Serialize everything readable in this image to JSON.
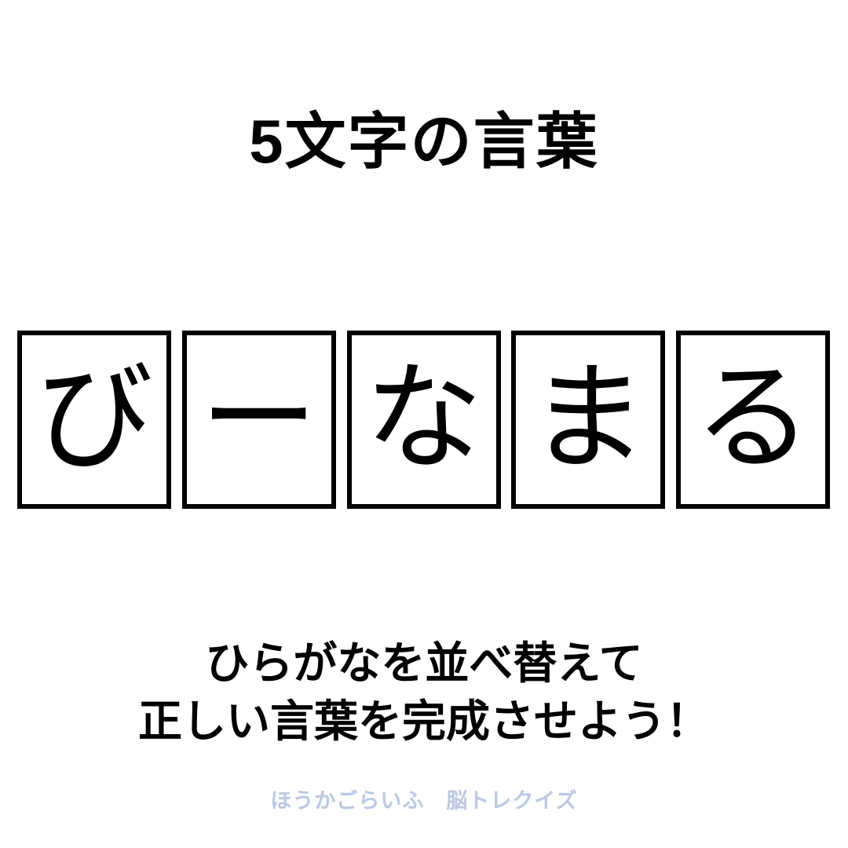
{
  "background_color": "#ffffff",
  "title": {
    "text": "5文字の言葉",
    "color": "#000000"
  },
  "tiles": {
    "count": 5,
    "border_color": "#000000",
    "fill_color": "#ffffff",
    "letters": [
      {
        "char": "び",
        "name": "tile-letter-bi"
      },
      {
        "char": "ー",
        "name": "tile-letter-choon"
      },
      {
        "char": "な",
        "name": "tile-letter-na"
      },
      {
        "char": "ま",
        "name": "tile-letter-ma"
      },
      {
        "char": "る",
        "name": "tile-letter-ru"
      }
    ]
  },
  "instruction": {
    "line1": "ひらがなを並べ替えて",
    "line2": "正しい言葉を完成させよう！",
    "color": "#000000"
  },
  "footer": {
    "text": "ほうかごらいふ　脳トレクイズ",
    "color": "#b9c9e6"
  }
}
